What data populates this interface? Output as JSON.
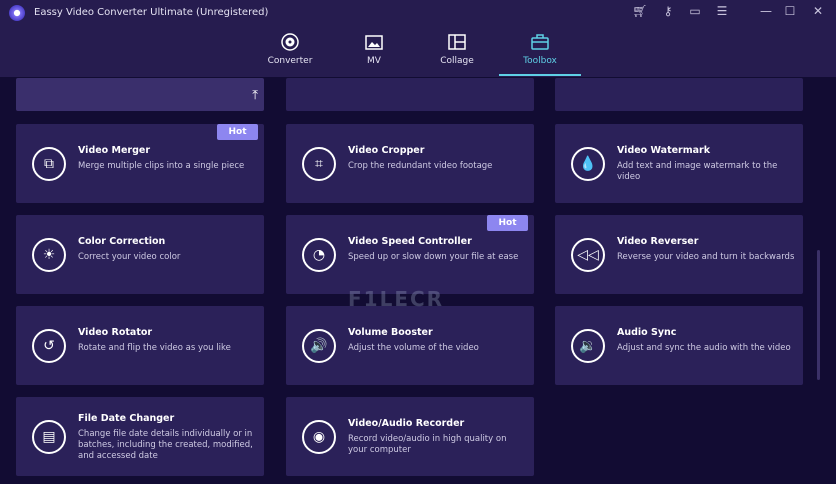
{
  "app": {
    "title": "Eassy Video Converter Ultimate (Unregistered)"
  },
  "window_controls": [
    "cart-icon",
    "key-icon",
    "feedback-icon",
    "menu-icon",
    "minimize-icon",
    "maximize-icon",
    "close-icon"
  ],
  "tabs": [
    {
      "label": "Converter",
      "icon": "converter-icon"
    },
    {
      "label": "MV",
      "icon": "tv-icon"
    },
    {
      "label": "Collage",
      "icon": "collage-icon"
    },
    {
      "label": "Toolbox",
      "icon": "toolbox-icon",
      "active": true
    }
  ],
  "accent": "#5fd0e6",
  "tools": [
    {
      "name": "Video Merger",
      "desc": "Merge multiple clips into a single piece",
      "badge": "Hot",
      "icon": "merge-icon",
      "glyph": "⧉"
    },
    {
      "name": "Video Cropper",
      "desc": "Crop the redundant video footage",
      "icon": "crop-icon",
      "glyph": "⌗"
    },
    {
      "name": "Video Watermark",
      "desc": "Add text and image watermark to the video",
      "icon": "drop-icon",
      "glyph": "💧"
    },
    {
      "name": "Color Correction",
      "desc": "Correct your video color",
      "icon": "sun-icon",
      "glyph": "☀"
    },
    {
      "name": "Video Speed Controller",
      "desc": "Speed up or slow down your file at ease",
      "badge": "Hot",
      "icon": "speedometer-icon",
      "glyph": "◔"
    },
    {
      "name": "Video Reverser",
      "desc": "Reverse your video and turn it backwards",
      "icon": "rewind-icon",
      "glyph": "◁◁"
    },
    {
      "name": "Video Rotator",
      "desc": "Rotate and flip the video as you like",
      "icon": "rotate-icon",
      "glyph": "↺"
    },
    {
      "name": "Volume Booster",
      "desc": "Adjust the volume of the video",
      "icon": "volume-icon",
      "glyph": "🔊"
    },
    {
      "name": "Audio Sync",
      "desc": "Adjust and sync the audio with the video",
      "icon": "audio-sync-icon",
      "glyph": "🔉"
    },
    {
      "name": "File Date Changer",
      "desc": "Change file date details individually or in batches, including the created, modified, and accessed date",
      "icon": "file-date-icon",
      "glyph": "▤"
    },
    {
      "name": "Video/Audio Recorder",
      "desc": "Record video/audio in high quality on your computer",
      "icon": "camera-icon",
      "glyph": "◉"
    }
  ],
  "watermark": "FILECR"
}
